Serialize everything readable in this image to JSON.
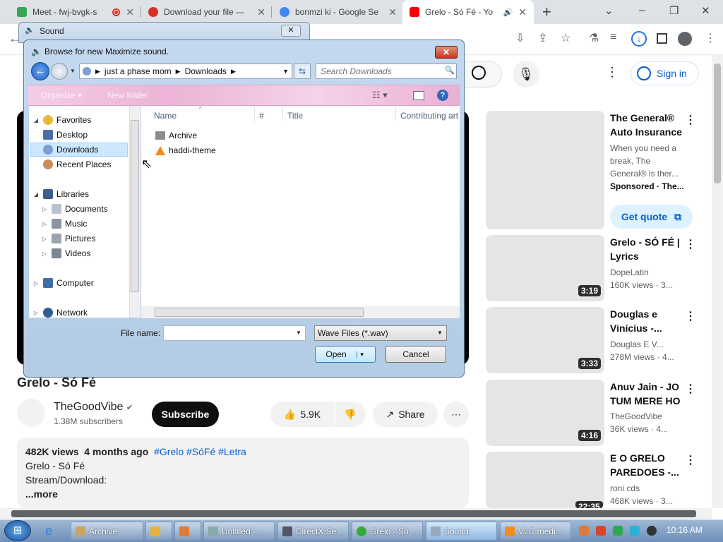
{
  "browser": {
    "tabs": [
      {
        "title": "Meet - fwj-bvgk-s",
        "favicon_color": "#34a853",
        "recording": true
      },
      {
        "title": "Download your file —",
        "favicon_color": "#d93025"
      },
      {
        "title": "bonmzi ki - Google Se",
        "favicon_color": "#4285f4"
      },
      {
        "title": "Grelo - Só Fé - Yo",
        "favicon_color": "#ff0000",
        "active": true
      }
    ],
    "new_tab": "+",
    "window_controls": [
      "⌄",
      "–",
      "❐",
      "✕"
    ],
    "toolbar_icons": [
      "install-icon",
      "share-icon",
      "star-icon",
      "extension-icon",
      "reading-list-icon",
      "download-icon",
      "sidepanel-icon",
      "profile-icon",
      "menu-icon"
    ]
  },
  "youtube": {
    "signin": "Sign in",
    "video_title": "Grelo - Só Fé",
    "channel": {
      "name": "TheGoodVibe",
      "verified": "✔",
      "subs": "1.38M subscribers"
    },
    "subscribe": "Subscribe",
    "likes": "5.9K",
    "share": "Share",
    "more": "⋯",
    "description": {
      "views": "482K views",
      "age": "4 months ago",
      "tags": "#Grelo #SóFé #Letra",
      "line1": "Grelo - Só Fé",
      "line2": "Stream/Download:",
      "more": "...more"
    },
    "sidebar": [
      {
        "title": "The General® Auto Insurance",
        "line1": "When you need a break, The General® is ther...",
        "line2": "Sponsored · The...",
        "cta": "Get quote"
      },
      {
        "title": "Grelo - SÓ FÉ | Lyrics",
        "channel": "DopeLatin",
        "meta": "160K views · 3...",
        "duration": "3:19"
      },
      {
        "title": "Douglas e Vinícius -...",
        "channel": "Douglas E V...",
        "meta": "278M views · 4...",
        "duration": "3:33"
      },
      {
        "title": "Anuv Jain - JO TUM MERE HO",
        "channel": "TheGoodVibe",
        "meta": "36K views · 4...",
        "duration": "4:16"
      },
      {
        "title": "E O GRELO PAREDOES -...",
        "channel": "roni cds",
        "meta": "468K views · 3...",
        "duration": "22:35"
      }
    ]
  },
  "sound_window": {
    "title": "Sound",
    "close": "✕"
  },
  "dialog": {
    "title": "Browse for new Maximize sound.",
    "breadcrumb": [
      "just a phase mom",
      "Downloads"
    ],
    "search_placeholder": "Search Downloads",
    "cmd_organize": "Organize ▾",
    "cmd_newfolder": "New folder",
    "nav": {
      "favorites": "Favorites",
      "desktop": "Desktop",
      "downloads": "Downloads",
      "recent": "Recent Places",
      "libraries": "Libraries",
      "documents": "Documents",
      "music": "Music",
      "pictures": "Pictures",
      "videos": "Videos",
      "computer": "Computer",
      "network": "Network"
    },
    "columns": [
      "Name",
      "#",
      "Title",
      "Contributing art"
    ],
    "files": [
      {
        "name": "Archive",
        "type": "folder"
      },
      {
        "name": "haddi-theme",
        "type": "vlc"
      }
    ],
    "filename_label": "File name:",
    "filename_value": "",
    "filetype": "Wave Files (*.wav)",
    "open": "Open",
    "cancel": "Cancel"
  },
  "taskbar": {
    "items": [
      {
        "label": "Archive",
        "color": "#c9a463"
      },
      {
        "label": "",
        "color": "#e7b33a"
      },
      {
        "label": "",
        "color": "#e07a3a"
      },
      {
        "label": "Untitled - ...",
        "color": "#8aa"
      },
      {
        "label": "DirectX Se...",
        "color": "#556"
      },
      {
        "label": "Grelo - Só ...",
        "color": "#3a3"
      },
      {
        "label": "Sound",
        "color": "#9ab",
        "active": true
      },
      {
        "label": "VLC medi...",
        "color": "#f28c1c"
      }
    ],
    "clock": "10:16 AM"
  }
}
